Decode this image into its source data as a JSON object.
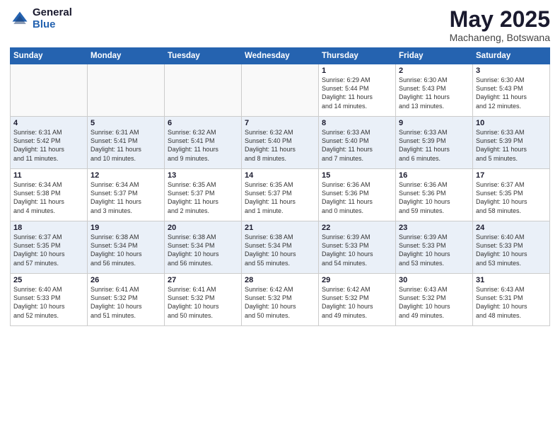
{
  "header": {
    "logo_general": "General",
    "logo_blue": "Blue",
    "title": "May 2025",
    "subtitle": "Machaneng, Botswana"
  },
  "weekdays": [
    "Sunday",
    "Monday",
    "Tuesday",
    "Wednesday",
    "Thursday",
    "Friday",
    "Saturday"
  ],
  "weeks": [
    [
      {
        "day": "",
        "info": ""
      },
      {
        "day": "",
        "info": ""
      },
      {
        "day": "",
        "info": ""
      },
      {
        "day": "",
        "info": ""
      },
      {
        "day": "1",
        "info": "Sunrise: 6:29 AM\nSunset: 5:44 PM\nDaylight: 11 hours\nand 14 minutes."
      },
      {
        "day": "2",
        "info": "Sunrise: 6:30 AM\nSunset: 5:43 PM\nDaylight: 11 hours\nand 13 minutes."
      },
      {
        "day": "3",
        "info": "Sunrise: 6:30 AM\nSunset: 5:43 PM\nDaylight: 11 hours\nand 12 minutes."
      }
    ],
    [
      {
        "day": "4",
        "info": "Sunrise: 6:31 AM\nSunset: 5:42 PM\nDaylight: 11 hours\nand 11 minutes."
      },
      {
        "day": "5",
        "info": "Sunrise: 6:31 AM\nSunset: 5:41 PM\nDaylight: 11 hours\nand 10 minutes."
      },
      {
        "day": "6",
        "info": "Sunrise: 6:32 AM\nSunset: 5:41 PM\nDaylight: 11 hours\nand 9 minutes."
      },
      {
        "day": "7",
        "info": "Sunrise: 6:32 AM\nSunset: 5:40 PM\nDaylight: 11 hours\nand 8 minutes."
      },
      {
        "day": "8",
        "info": "Sunrise: 6:33 AM\nSunset: 5:40 PM\nDaylight: 11 hours\nand 7 minutes."
      },
      {
        "day": "9",
        "info": "Sunrise: 6:33 AM\nSunset: 5:39 PM\nDaylight: 11 hours\nand 6 minutes."
      },
      {
        "day": "10",
        "info": "Sunrise: 6:33 AM\nSunset: 5:39 PM\nDaylight: 11 hours\nand 5 minutes."
      }
    ],
    [
      {
        "day": "11",
        "info": "Sunrise: 6:34 AM\nSunset: 5:38 PM\nDaylight: 11 hours\nand 4 minutes."
      },
      {
        "day": "12",
        "info": "Sunrise: 6:34 AM\nSunset: 5:37 PM\nDaylight: 11 hours\nand 3 minutes."
      },
      {
        "day": "13",
        "info": "Sunrise: 6:35 AM\nSunset: 5:37 PM\nDaylight: 11 hours\nand 2 minutes."
      },
      {
        "day": "14",
        "info": "Sunrise: 6:35 AM\nSunset: 5:37 PM\nDaylight: 11 hours\nand 1 minute."
      },
      {
        "day": "15",
        "info": "Sunrise: 6:36 AM\nSunset: 5:36 PM\nDaylight: 11 hours\nand 0 minutes."
      },
      {
        "day": "16",
        "info": "Sunrise: 6:36 AM\nSunset: 5:36 PM\nDaylight: 10 hours\nand 59 minutes."
      },
      {
        "day": "17",
        "info": "Sunrise: 6:37 AM\nSunset: 5:35 PM\nDaylight: 10 hours\nand 58 minutes."
      }
    ],
    [
      {
        "day": "18",
        "info": "Sunrise: 6:37 AM\nSunset: 5:35 PM\nDaylight: 10 hours\nand 57 minutes."
      },
      {
        "day": "19",
        "info": "Sunrise: 6:38 AM\nSunset: 5:34 PM\nDaylight: 10 hours\nand 56 minutes."
      },
      {
        "day": "20",
        "info": "Sunrise: 6:38 AM\nSunset: 5:34 PM\nDaylight: 10 hours\nand 56 minutes."
      },
      {
        "day": "21",
        "info": "Sunrise: 6:38 AM\nSunset: 5:34 PM\nDaylight: 10 hours\nand 55 minutes."
      },
      {
        "day": "22",
        "info": "Sunrise: 6:39 AM\nSunset: 5:33 PM\nDaylight: 10 hours\nand 54 minutes."
      },
      {
        "day": "23",
        "info": "Sunrise: 6:39 AM\nSunset: 5:33 PM\nDaylight: 10 hours\nand 53 minutes."
      },
      {
        "day": "24",
        "info": "Sunrise: 6:40 AM\nSunset: 5:33 PM\nDaylight: 10 hours\nand 53 minutes."
      }
    ],
    [
      {
        "day": "25",
        "info": "Sunrise: 6:40 AM\nSunset: 5:33 PM\nDaylight: 10 hours\nand 52 minutes."
      },
      {
        "day": "26",
        "info": "Sunrise: 6:41 AM\nSunset: 5:32 PM\nDaylight: 10 hours\nand 51 minutes."
      },
      {
        "day": "27",
        "info": "Sunrise: 6:41 AM\nSunset: 5:32 PM\nDaylight: 10 hours\nand 50 minutes."
      },
      {
        "day": "28",
        "info": "Sunrise: 6:42 AM\nSunset: 5:32 PM\nDaylight: 10 hours\nand 50 minutes."
      },
      {
        "day": "29",
        "info": "Sunrise: 6:42 AM\nSunset: 5:32 PM\nDaylight: 10 hours\nand 49 minutes."
      },
      {
        "day": "30",
        "info": "Sunrise: 6:43 AM\nSunset: 5:32 PM\nDaylight: 10 hours\nand 49 minutes."
      },
      {
        "day": "31",
        "info": "Sunrise: 6:43 AM\nSunset: 5:31 PM\nDaylight: 10 hours\nand 48 minutes."
      }
    ]
  ]
}
